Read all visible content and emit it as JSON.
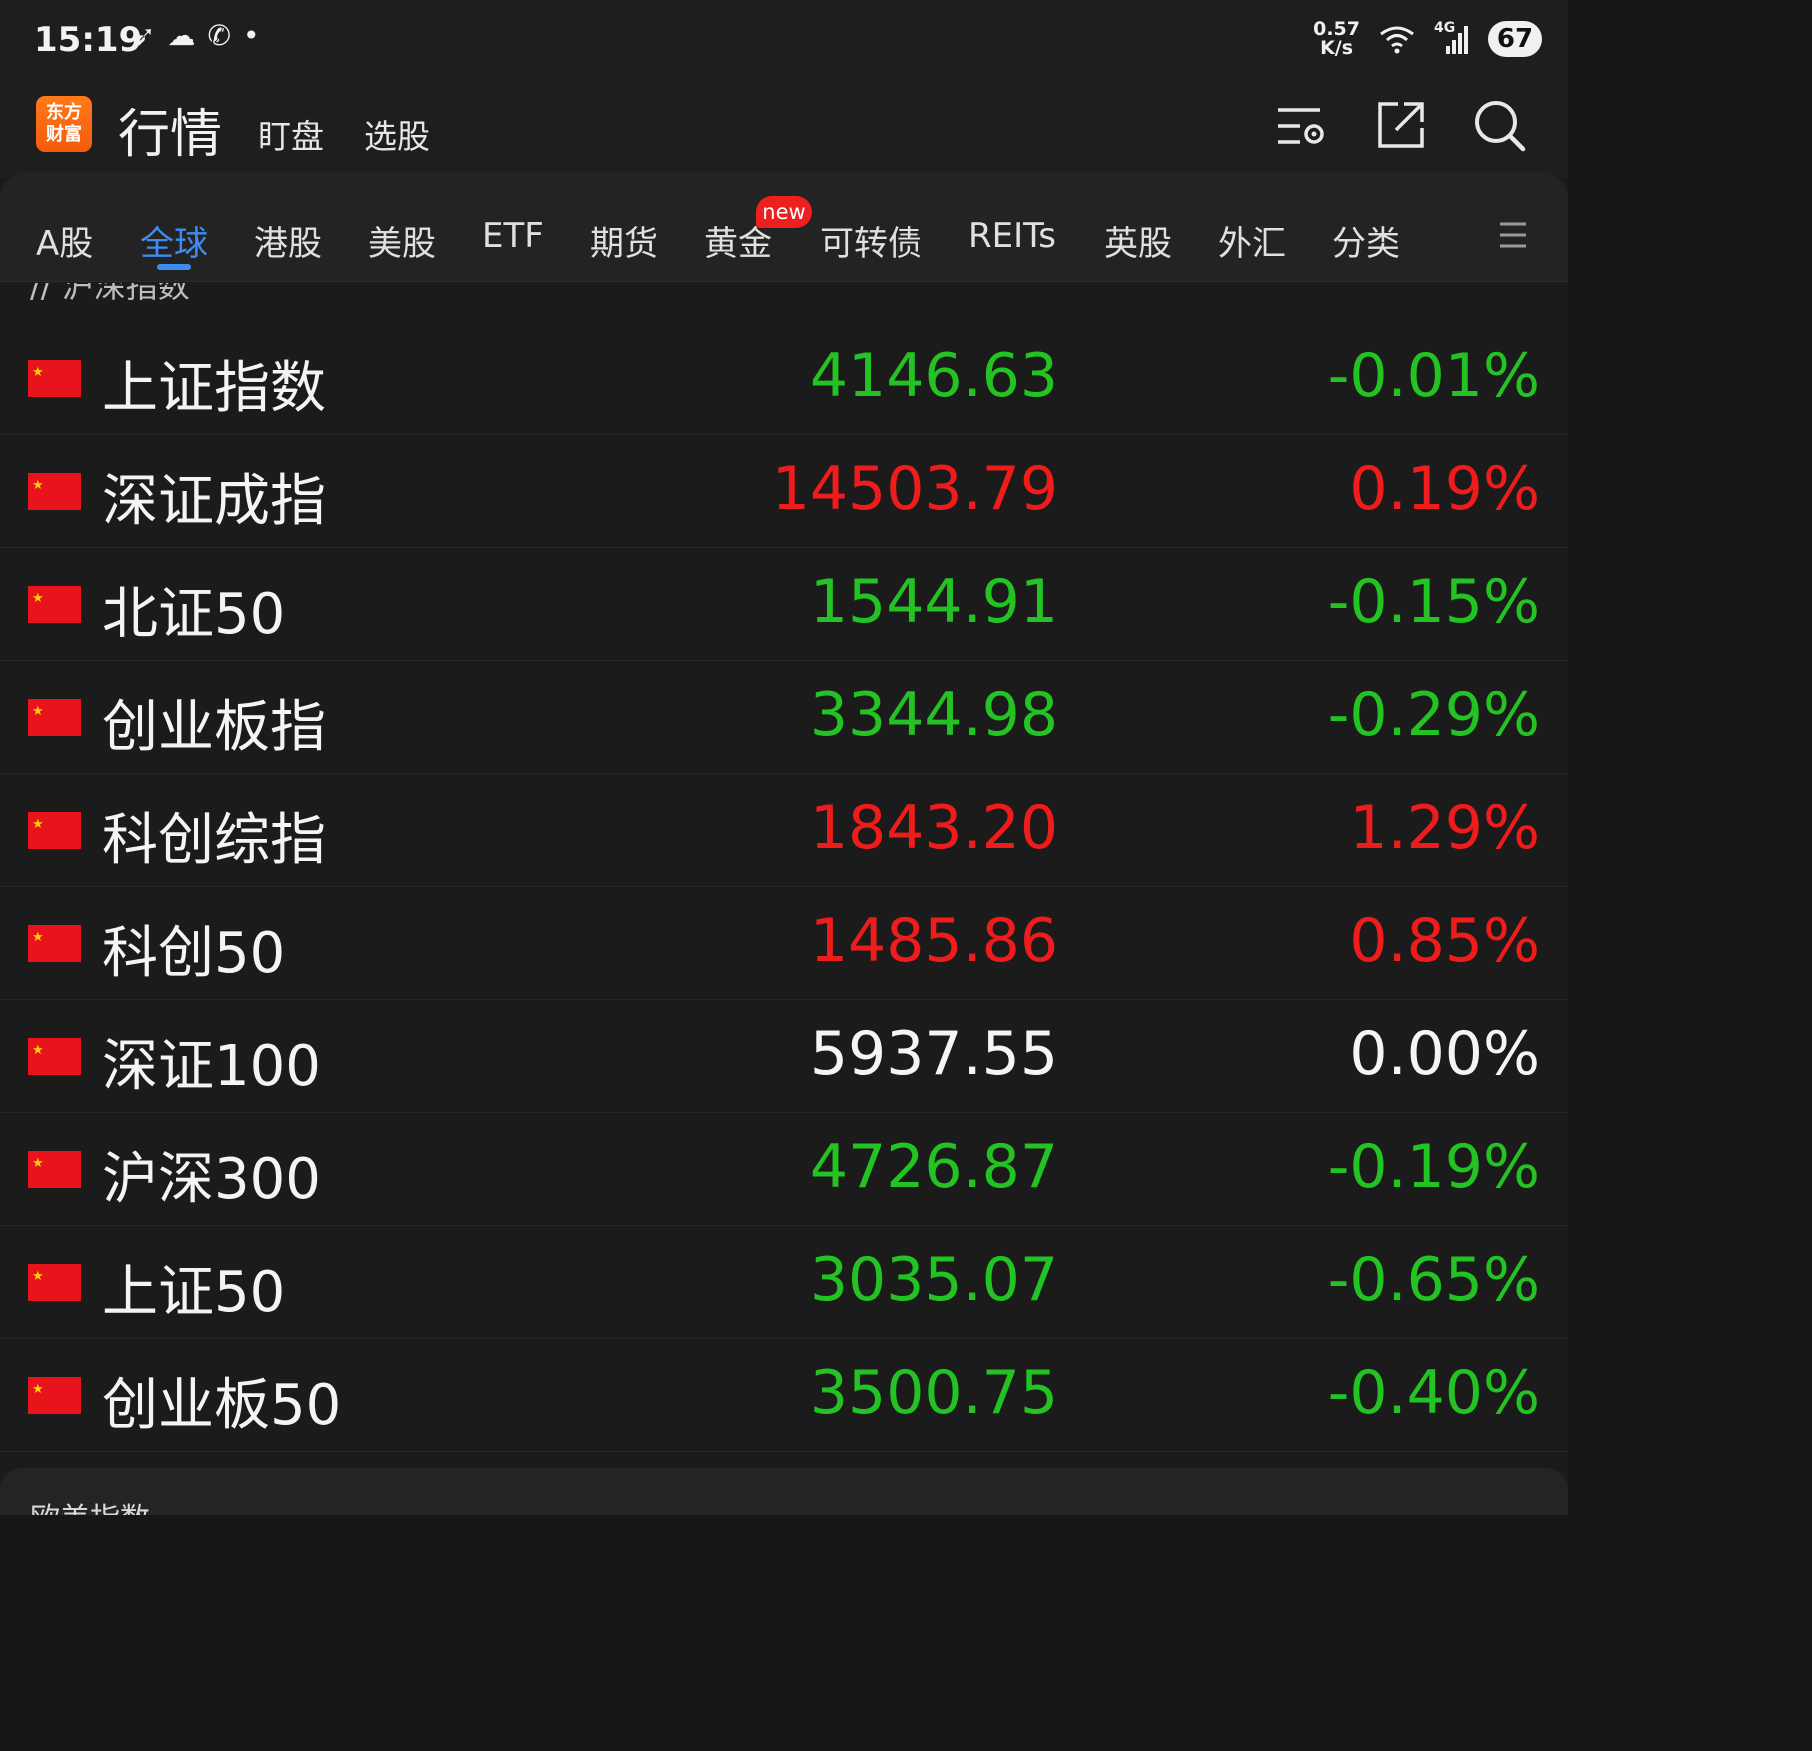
{
  "status_bar": {
    "time": "15:19",
    "icons": [
      "send-icon",
      "wechat-icon",
      "phone-icon",
      "dot-icon"
    ],
    "net_speed_value": "0.57",
    "net_speed_unit": "K/s",
    "signal_label": "4G",
    "battery": "67"
  },
  "header": {
    "logo_line1": "东方",
    "logo_line2": "财富",
    "title": "行情",
    "sub_tabs": [
      "盯盘",
      "选股"
    ]
  },
  "tabs": {
    "items": [
      "A股",
      "全球",
      "港股",
      "美股",
      "ETF",
      "期货",
      "黄金",
      "可转债",
      "REITs",
      "英股",
      "外汇",
      "分类"
    ],
    "active_index": 1,
    "badge": "new"
  },
  "section_top": {
    "title": "// 沪深指数"
  },
  "colors": {
    "up": "#f01c1c",
    "down": "#22c322",
    "flat": "#f5f5f5",
    "accent": "#3d8cf2"
  },
  "rows": [
    {
      "name": "上证指数",
      "price": "4146.63",
      "change": "-0.01%",
      "trend": "down"
    },
    {
      "name": "深证成指",
      "price": "14503.79",
      "change": "0.19%",
      "trend": "up"
    },
    {
      "name": "北证50",
      "price": "1544.91",
      "change": "-0.15%",
      "trend": "down"
    },
    {
      "name": "创业板指",
      "price": "3344.98",
      "change": "-0.29%",
      "trend": "down"
    },
    {
      "name": "科创综指",
      "price": "1843.20",
      "change": "1.29%",
      "trend": "up"
    },
    {
      "name": "科创50",
      "price": "1485.86",
      "change": "0.85%",
      "trend": "up"
    },
    {
      "name": "深证100",
      "price": "5937.55",
      "change": "0.00%",
      "trend": "flat"
    },
    {
      "name": "沪深300",
      "price": "4726.87",
      "change": "-0.19%",
      "trend": "down"
    },
    {
      "name": "上证50",
      "price": "3035.07",
      "change": "-0.65%",
      "trend": "down"
    },
    {
      "name": "创业板50",
      "price": "3500.75",
      "change": "-0.40%",
      "trend": "down"
    }
  ],
  "section_bottom": {
    "title": "欧美指数"
  }
}
